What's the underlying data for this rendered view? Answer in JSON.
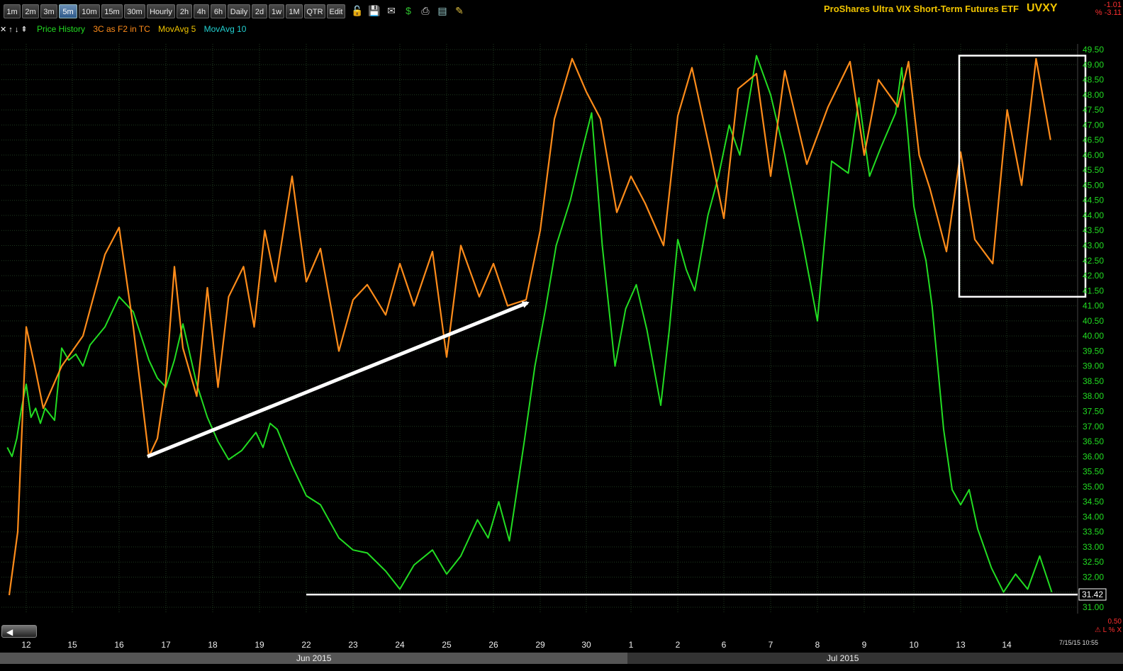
{
  "toolbar": {
    "timeframes": [
      "1m",
      "2m",
      "3m",
      "5m",
      "10m",
      "15m",
      "30m",
      "Hourly",
      "2h",
      "4h",
      "6h",
      "Daily",
      "2d",
      "1w",
      "1M",
      "QTR",
      "Edit"
    ],
    "active": "5m",
    "icons": [
      "lock-icon",
      "save-icon",
      "mail-icon",
      "dollar-icon",
      "print-icon",
      "card-icon",
      "pencil-icon"
    ]
  },
  "header": {
    "title": "ProShares Ultra VIX Short-Term Futures ETF",
    "symbol": "UVXY",
    "change_value": "-1.01",
    "change_pct": "% -3.11"
  },
  "legend": {
    "nav_glyphs": "✕ ↑ ↓ ⇞",
    "items": [
      {
        "label": "Price History",
        "color": "#22dd22"
      },
      {
        "label": "3C as F2 in TC",
        "color": "#ff8c1a"
      },
      {
        "label": "MovAvg 5",
        "color": "#f0c400"
      },
      {
        "label": "MovAvg 10",
        "color": "#22d0d0"
      }
    ]
  },
  "footer": {
    "timestamp": "7/15/15 10:55",
    "month_left": "Jun 2015",
    "month_right": "Jul 2015",
    "scroll_glyph": "◀",
    "right_value": "0.50",
    "right_icons": "⚠ L % X"
  },
  "chart_data": {
    "type": "line",
    "xlabel": "",
    "ylabel": "",
    "x_ticks": [
      "12",
      "15",
      "16",
      "17",
      "18",
      "19",
      "22",
      "23",
      "24",
      "25",
      "26",
      "29",
      "30",
      "1",
      "2",
      "6",
      "7",
      "8",
      "9",
      "10",
      "13",
      "14"
    ],
    "y_ticks": [
      "49.50",
      "49.00",
      "48.50",
      "48.00",
      "47.50",
      "47.00",
      "46.50",
      "46.00",
      "45.50",
      "45.00",
      "44.50",
      "44.00",
      "43.50",
      "43.00",
      "42.50",
      "42.00",
      "41.50",
      "41.00",
      "40.50",
      "40.00",
      "39.50",
      "39.00",
      "38.50",
      "38.00",
      "37.50",
      "37.00",
      "36.50",
      "36.00",
      "35.50",
      "35.00",
      "34.50",
      "34.00",
      "33.50",
      "33.00",
      "32.50",
      "32.00",
      "31.50",
      "31.00"
    ],
    "ylim": [
      31.0,
      49.5
    ],
    "grid": true,
    "last_price_label": "31.42",
    "series": [
      {
        "name": "Price History",
        "color": "#22dd22",
        "points": [
          [
            "12",
            36.3
          ],
          [
            "12",
            36.0
          ],
          [
            "12",
            36.6
          ],
          [
            "12",
            37.6
          ],
          [
            "12",
            38.4
          ],
          [
            "12",
            37.3
          ],
          [
            "12",
            37.6
          ],
          [
            "12",
            37.1
          ],
          [
            "12",
            37.6
          ],
          [
            "15",
            37.2
          ],
          [
            "15",
            39.6
          ],
          [
            "15",
            39.2
          ],
          [
            "15",
            39.4
          ],
          [
            "15",
            39.0
          ],
          [
            "15",
            39.7
          ],
          [
            "16",
            40.3
          ],
          [
            "16",
            41.3
          ],
          [
            "16",
            40.8
          ],
          [
            "17",
            39.2
          ],
          [
            "17",
            38.6
          ],
          [
            "17",
            38.3
          ],
          [
            "17",
            39.2
          ],
          [
            "17",
            40.4
          ],
          [
            "18",
            38.4
          ],
          [
            "18",
            37.3
          ],
          [
            "18",
            36.5
          ],
          [
            "18",
            35.9
          ],
          [
            "19",
            36.2
          ],
          [
            "19",
            36.5
          ],
          [
            "19",
            36.8
          ],
          [
            "19",
            36.3
          ],
          [
            "19",
            37.1
          ],
          [
            "19",
            36.9
          ],
          [
            "22",
            35.7
          ],
          [
            "22",
            34.7
          ],
          [
            "22",
            34.4
          ],
          [
            "23",
            33.3
          ],
          [
            "23",
            32.9
          ],
          [
            "23",
            32.8
          ],
          [
            "24",
            32.2
          ],
          [
            "24",
            31.6
          ],
          [
            "24",
            32.4
          ],
          [
            "25",
            32.9
          ],
          [
            "25",
            32.1
          ],
          [
            "25",
            32.7
          ],
          [
            "26",
            33.9
          ],
          [
            "26",
            33.3
          ],
          [
            "26",
            34.5
          ],
          [
            "26",
            33.2
          ],
          [
            "29",
            36.5
          ],
          [
            "29",
            39.0
          ],
          [
            "29",
            40.9
          ],
          [
            "29",
            43.0
          ],
          [
            "30",
            44.5
          ],
          [
            "30",
            46.0
          ],
          [
            "30",
            47.4
          ],
          [
            "30",
            43.0
          ],
          [
            "1",
            39.0
          ],
          [
            "1",
            40.9
          ],
          [
            "1",
            41.7
          ],
          [
            "1",
            40.2
          ],
          [
            "2",
            37.7
          ],
          [
            "2",
            40.2
          ],
          [
            "2",
            43.2
          ],
          [
            "2",
            42.2
          ],
          [
            "2",
            41.5
          ],
          [
            "6",
            44.0
          ],
          [
            "6",
            45.3
          ],
          [
            "6",
            47.0
          ],
          [
            "6",
            46.0
          ],
          [
            "7",
            49.3
          ],
          [
            "7",
            48.0
          ],
          [
            "7",
            46.0
          ],
          [
            "8",
            43.0
          ],
          [
            "8",
            40.5
          ],
          [
            "8",
            45.8
          ],
          [
            "9",
            45.4
          ],
          [
            "9",
            47.9
          ],
          [
            "9",
            45.3
          ],
          [
            "9",
            46.2
          ],
          [
            "10",
            47.4
          ],
          [
            "10",
            48.9
          ],
          [
            "10",
            46.7
          ],
          [
            "10",
            44.3
          ],
          [
            "10",
            43.3
          ],
          [
            "10",
            42.5
          ],
          [
            "10",
            41.0
          ],
          [
            "13",
            36.9
          ],
          [
            "13",
            34.9
          ],
          [
            "13",
            34.4
          ],
          [
            "13",
            34.9
          ],
          [
            "13",
            33.6
          ],
          [
            "14",
            32.3
          ],
          [
            "14",
            31.5
          ],
          [
            "14",
            32.1
          ],
          [
            "14",
            31.6
          ],
          [
            "14",
            32.7
          ],
          [
            "14",
            31.5
          ]
        ]
      },
      {
        "name": "3C as F2 in TC",
        "color": "#ff8c1a",
        "points": [
          [
            "12",
            31.4
          ],
          [
            "12",
            33.5
          ],
          [
            "12",
            40.3
          ],
          [
            "12",
            39.0
          ],
          [
            "12",
            37.6
          ],
          [
            "15",
            39.0
          ],
          [
            "15",
            40.0
          ],
          [
            "16",
            42.7
          ],
          [
            "16",
            43.6
          ],
          [
            "16",
            40.3
          ],
          [
            "17",
            36.0
          ],
          [
            "17",
            36.6
          ],
          [
            "17",
            38.5
          ],
          [
            "17",
            42.3
          ],
          [
            "17",
            39.6
          ],
          [
            "18",
            38.0
          ],
          [
            "18",
            41.6
          ],
          [
            "18",
            38.3
          ],
          [
            "18",
            41.3
          ],
          [
            "19",
            42.3
          ],
          [
            "19",
            40.3
          ],
          [
            "19",
            43.5
          ],
          [
            "19",
            41.8
          ],
          [
            "22",
            45.3
          ],
          [
            "22",
            41.8
          ],
          [
            "22",
            42.9
          ],
          [
            "23",
            39.5
          ],
          [
            "23",
            41.2
          ],
          [
            "23",
            41.7
          ],
          [
            "24",
            40.7
          ],
          [
            "24",
            42.4
          ],
          [
            "24",
            41.0
          ],
          [
            "25",
            42.8
          ],
          [
            "25",
            39.3
          ],
          [
            "25",
            43.0
          ],
          [
            "26",
            41.3
          ],
          [
            "26",
            42.4
          ],
          [
            "26",
            41.0
          ],
          [
            "29",
            41.2
          ],
          [
            "29",
            43.5
          ],
          [
            "29",
            47.2
          ],
          [
            "30",
            49.2
          ],
          [
            "30",
            48.1
          ],
          [
            "30",
            47.2
          ],
          [
            "1",
            44.1
          ],
          [
            "1",
            45.3
          ],
          [
            "1",
            44.4
          ],
          [
            "2",
            43.0
          ],
          [
            "2",
            47.3
          ],
          [
            "2",
            48.9
          ],
          [
            "6",
            46.2
          ],
          [
            "6",
            43.9
          ],
          [
            "6",
            48.2
          ],
          [
            "7",
            48.7
          ],
          [
            "7",
            45.3
          ],
          [
            "7",
            48.8
          ],
          [
            "8",
            45.7
          ],
          [
            "8",
            47.6
          ],
          [
            "9",
            49.1
          ],
          [
            "9",
            46.0
          ],
          [
            "9",
            48.5
          ],
          [
            "10",
            47.6
          ],
          [
            "10",
            49.1
          ],
          [
            "10",
            46.0
          ],
          [
            "10",
            44.9
          ],
          [
            "13",
            42.8
          ],
          [
            "13",
            46.1
          ],
          [
            "13",
            43.2
          ],
          [
            "14",
            42.4
          ],
          [
            "14",
            47.5
          ],
          [
            "14",
            45.0
          ],
          [
            "14",
            49.2
          ],
          [
            "14",
            46.5
          ]
        ]
      }
    ],
    "annotations": [
      {
        "type": "arrow",
        "color": "#ffffff",
        "from": [
          "17",
          36.0
        ],
        "to": [
          "29",
          41.1
        ]
      },
      {
        "type": "hline",
        "color": "#ffffff",
        "y": 31.42,
        "from_x": "22",
        "to_x": "14"
      },
      {
        "type": "rect",
        "color": "#ffffff",
        "x_from": "13",
        "x_to": "14",
        "y_low": 41.3,
        "y_high": 49.3
      }
    ]
  }
}
